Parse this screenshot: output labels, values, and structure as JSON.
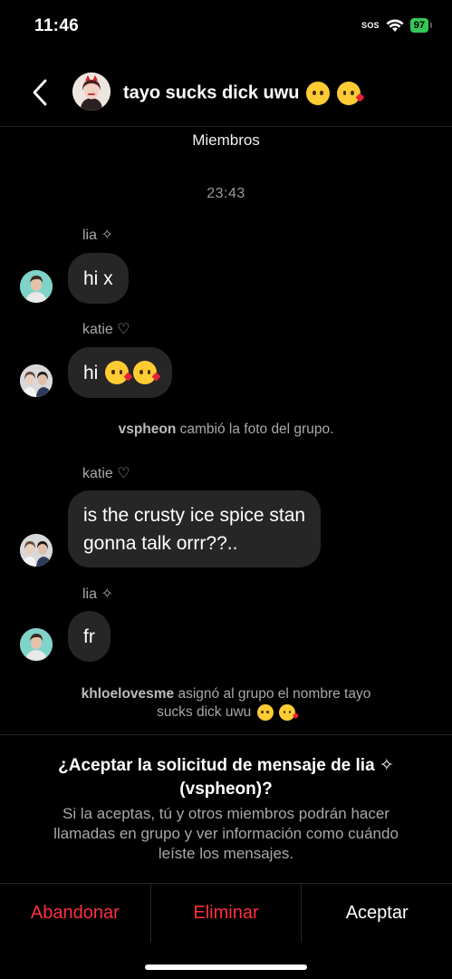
{
  "status": {
    "time": "11:46",
    "sos": "SOS",
    "battery": "97"
  },
  "header": {
    "title": "tayo sucks dick uwu",
    "title_emojis": [
      "pleading-face",
      "face-blowing-kiss"
    ]
  },
  "members_link": "Miembros",
  "timestamp": "23:43",
  "messages": [
    {
      "sender": "lia ✧",
      "text": "hi x"
    },
    {
      "sender": "katie ♡",
      "text": "hi",
      "emojis": [
        "face-blowing-kiss",
        "face-blowing-kiss"
      ]
    },
    {
      "sender": "katie ♡",
      "text_line1": "is the crusty ice spice stan",
      "text_line2": "gonna talk orrr??.."
    },
    {
      "sender": "lia ✧",
      "text": "fr"
    }
  ],
  "system_messages": {
    "photo_change": {
      "user": "vspheon",
      "text": " cambió la foto del grupo."
    },
    "rename": {
      "user": "khloelovesme",
      "text_line1": " asignó al grupo el nombre tayo",
      "text_line2": "sucks dick uwu"
    }
  },
  "request": {
    "title_line1": "¿Aceptar la solicitud de mensaje de lia ✧",
    "title_line2": "(vspheon)?",
    "body_line1": "Si la aceptas, tú y otros miembros podrán hacer",
    "body_line2": "llamadas en grupo y ver información como cuándo",
    "body_line3": "leíste los mensajes."
  },
  "actions": {
    "leave": "Abandonar",
    "delete": "Eliminar",
    "accept": "Aceptar"
  },
  "colors": {
    "danger": "#ff3040",
    "bubble": "#262626",
    "battery": "#34c759"
  }
}
